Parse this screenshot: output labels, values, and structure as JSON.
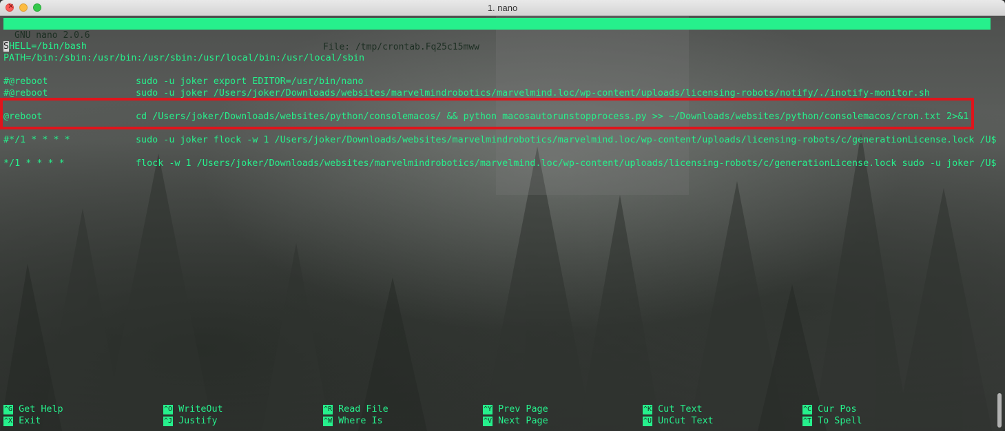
{
  "window": {
    "title": "1. nano"
  },
  "nano": {
    "version": "GNU nano 2.0.6",
    "file": "File: /tmp/crontab.Fq25c15mww"
  },
  "lines": [
    {
      "cursor_char": "S",
      "rest": "HELL=/bin/bash"
    },
    {
      "col1": "PATH=/bin:/sbin:/usr/bin:/usr/sbin:/usr/local/bin:/usr/local/sbin"
    },
    {
      "col1": "#@reboot",
      "col2": "sudo -u joker export EDITOR=/usr/bin/nano"
    },
    {
      "col1": "#@reboot",
      "col2": "sudo -u joker /Users/joker/Downloads/websites/marvelmindrobotics/marvelmind.loc/wp-content/uploads/licensing-robots/notify/./inotify-monitor.sh"
    },
    {
      "col1": "@reboot",
      "col2": "cd /Users/joker/Downloads/websites/python/consolemacos/ && python macosautorunstopprocess.py >> ~/Downloads/websites/python/consolemacos/cron.txt 2>&1"
    },
    {
      "col1": "#*/1 * * * *",
      "col2": "sudo -u joker flock -w 1 /Users/joker/Downloads/websites/marvelmindrobotics/marvelmind.loc/wp-content/uploads/licensing-robots/c/generationLicense.lock /U$"
    },
    {
      "col1": "*/1 * * * *",
      "col2": "flock -w 1 /Users/joker/Downloads/websites/marvelmindrobotics/marvelmind.loc/wp-content/uploads/licensing-robots/c/generationLicense.lock sudo -u joker /U$"
    }
  ],
  "shortcuts": [
    {
      "key": "^G",
      "label": "Get Help"
    },
    {
      "key": "^O",
      "label": "WriteOut"
    },
    {
      "key": "^R",
      "label": "Read File"
    },
    {
      "key": "^Y",
      "label": "Prev Page"
    },
    {
      "key": "^K",
      "label": "Cut Text"
    },
    {
      "key": "^C",
      "label": "Cur Pos"
    },
    {
      "key": "^X",
      "label": "Exit"
    },
    {
      "key": "^J",
      "label": "Justify"
    },
    {
      "key": "^W",
      "label": "Where Is"
    },
    {
      "key": "^V",
      "label": "Next Page"
    },
    {
      "key": "^U",
      "label": "UnCut Text"
    },
    {
      "key": "^T",
      "label": "To Spell"
    }
  ],
  "colors": {
    "accent": "#26f08c",
    "highlight": "#e0141b"
  }
}
